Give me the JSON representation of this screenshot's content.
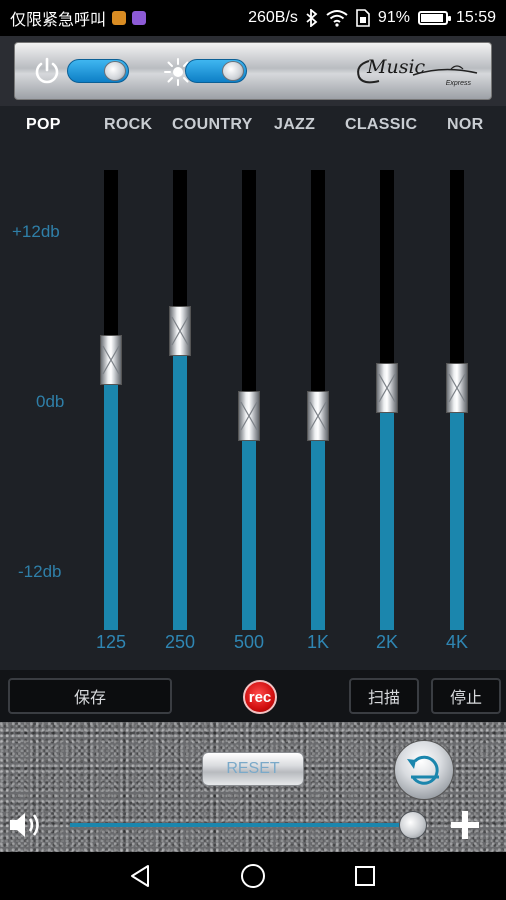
{
  "status_bar": {
    "carrier_text": "仅限紧急呼叫",
    "net_speed": "260B/s",
    "battery_percent": "91%",
    "battery_level": 0.91,
    "time": "15:59",
    "icons": [
      "app-notification-icon",
      "app-notification-icon",
      "bluetooth-icon",
      "wifi-icon",
      "sim-icon",
      "battery-icon"
    ]
  },
  "header": {
    "power_toggle_on": true,
    "brightness_toggle_on": true,
    "logo_text": "Music",
    "logo_sub": "Express"
  },
  "presets": {
    "items": [
      "POP",
      "ROCK",
      "COUNTRY",
      "JAZZ",
      "CLASSIC",
      "NOR"
    ],
    "active": "POP"
  },
  "db_labels": {
    "top": "+12db",
    "mid": "0db",
    "bottom": "-12db"
  },
  "bands": [
    {
      "freq": "125",
      "gain_db": 3
    },
    {
      "freq": "250",
      "gain_db": 5
    },
    {
      "freq": "500",
      "gain_db": -1
    },
    {
      "freq": "1K",
      "gain_db": -1
    },
    {
      "freq": "2K",
      "gain_db": 1
    },
    {
      "freq": "4K",
      "gain_db": 1
    }
  ],
  "controls": {
    "save_label": "保存",
    "rec_label": "rec",
    "scan_label": "扫描",
    "stop_label": "停止"
  },
  "bottom": {
    "reset_label": "RESET",
    "volume_level": 0.98
  },
  "colors": {
    "accent": "#1b86ad",
    "rec": "#d10f0f"
  }
}
